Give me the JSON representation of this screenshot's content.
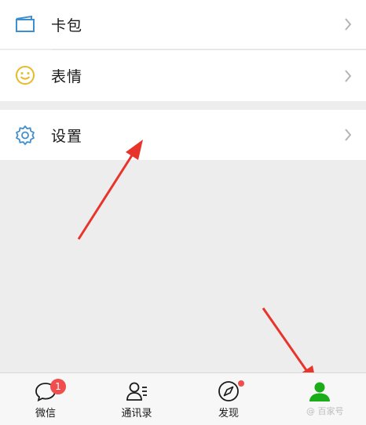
{
  "menu": {
    "items": [
      {
        "label": "卡包",
        "icon": "card-wallet-icon"
      },
      {
        "label": "表情",
        "icon": "smiley-icon"
      },
      {
        "label": "设置",
        "icon": "gear-icon"
      }
    ]
  },
  "tabbar": {
    "tabs": [
      {
        "label": "微信",
        "icon": "chat-bubble-icon",
        "badge": "1"
      },
      {
        "label": "通讯录",
        "icon": "contacts-icon"
      },
      {
        "label": "发现",
        "icon": "compass-icon"
      },
      {
        "label": "我",
        "icon": "person-icon",
        "active": true
      }
    ]
  },
  "colors": {
    "accent": "#1aad19",
    "badge": "#f04e4e",
    "annotation_arrow": "#e8342a"
  },
  "watermark": "@ 百家号"
}
